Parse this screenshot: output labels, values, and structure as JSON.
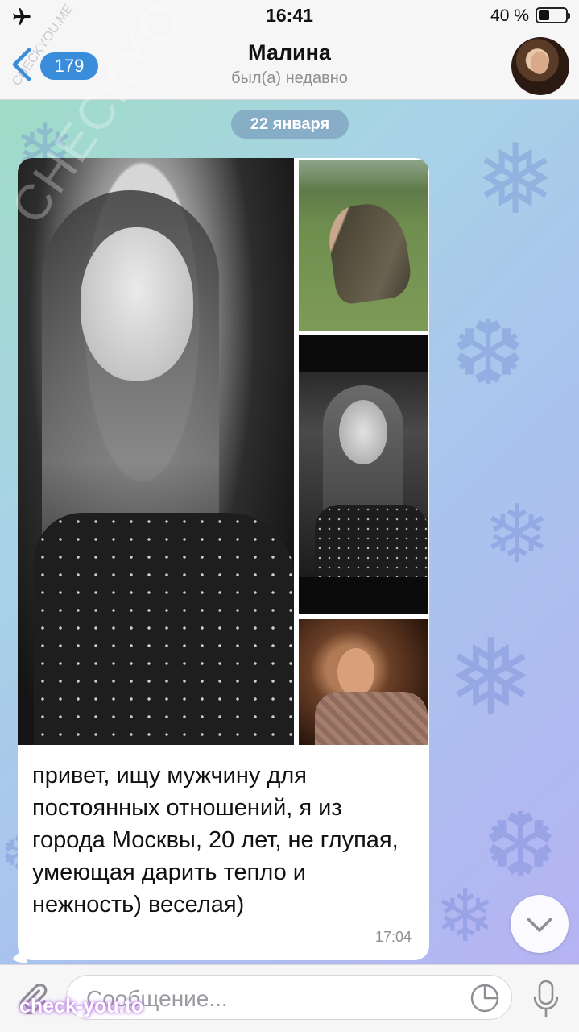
{
  "status_bar": {
    "time": "16:41",
    "battery_percent": "40 %",
    "battery_level": 0.4,
    "airplane_mode_icon": "airplane-icon"
  },
  "header": {
    "back_badge": "179",
    "title": "Малина",
    "subtitle": "был(а) недавно"
  },
  "chat": {
    "date_label": "22 января",
    "message": {
      "text": "привет, ищу мужчину для постоянных отношений, я из города Москвы, 20 лет, не глупая, умеющая дарить тепло и нежность) веселая)",
      "time": "17:04",
      "photo_count": 4
    }
  },
  "input": {
    "placeholder": "Сообщение..."
  },
  "watermarks": {
    "corner": "check-you.to",
    "diagonal": "CHECKYOU.ME",
    "top_small": "CHECKYOU.ME"
  },
  "colors": {
    "accent": "#3a8ddb",
    "bubble": "#ffffff",
    "wallpaper_start": "#9fdcc6",
    "wallpaper_end": "#b6b3f2"
  }
}
